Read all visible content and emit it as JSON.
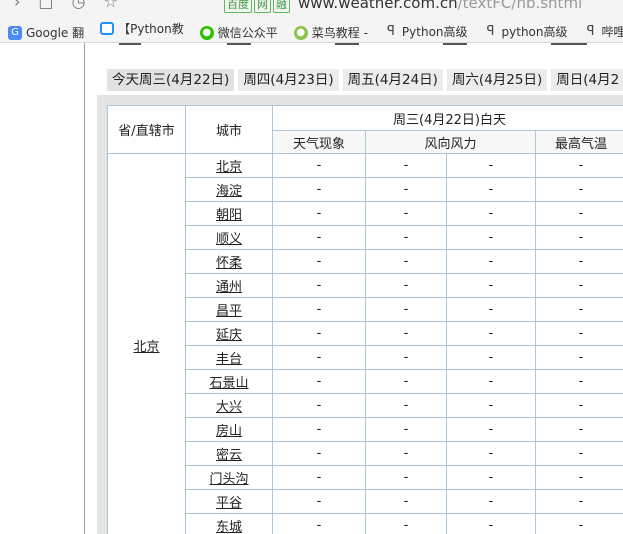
{
  "browser": {
    "url_badge_1": "百度",
    "url_badge_2": "网",
    "url_badge_3": "融",
    "url_host": "www.weather.com.cn",
    "url_path": "/textFC/hb.shtml",
    "bookmarks": [
      {
        "label": "Google 翻",
        "icon": "google-translate-icon"
      },
      {
        "label": "【Python教",
        "icon": "bilibili-icon"
      },
      {
        "label": "微信公众平",
        "icon": "wechat-icon"
      },
      {
        "label": "菜鸟教程 -",
        "icon": "runoob-icon"
      },
      {
        "label": "Python高级",
        "icon": "python-icon"
      },
      {
        "label": "python高级",
        "icon": "python-icon"
      },
      {
        "label": "哔哩哔",
        "icon": "python-icon"
      }
    ]
  },
  "tabs": [
    "今天周三(4月22日)",
    "周四(4月23日)",
    "周五(4月24日)",
    "周六(4月25日)",
    "周日(4月2"
  ],
  "table": {
    "header_province": "省/直辖市",
    "header_city": "城市",
    "header_period": "周三(4月22日)白天",
    "header_phenomenon": "天气现象",
    "header_wind": "风向风力",
    "header_max_temp": "最高气温",
    "province": "北京",
    "rows": [
      {
        "city": "北京",
        "phen": "-",
        "wdir": "-",
        "wpow": "-",
        "tmax": "-"
      },
      {
        "city": "海淀",
        "phen": "-",
        "wdir": "-",
        "wpow": "-",
        "tmax": "-"
      },
      {
        "city": "朝阳",
        "phen": "-",
        "wdir": "-",
        "wpow": "-",
        "tmax": "-"
      },
      {
        "city": "顺义",
        "phen": "-",
        "wdir": "-",
        "wpow": "-",
        "tmax": "-"
      },
      {
        "city": "怀柔",
        "phen": "-",
        "wdir": "-",
        "wpow": "-",
        "tmax": "-"
      },
      {
        "city": "通州",
        "phen": "-",
        "wdir": "-",
        "wpow": "-",
        "tmax": "-"
      },
      {
        "city": "昌平",
        "phen": "-",
        "wdir": "-",
        "wpow": "-",
        "tmax": "-"
      },
      {
        "city": "延庆",
        "phen": "-",
        "wdir": "-",
        "wpow": "-",
        "tmax": "-"
      },
      {
        "city": "丰台",
        "phen": "-",
        "wdir": "-",
        "wpow": "-",
        "tmax": "-"
      },
      {
        "city": "石景山",
        "phen": "-",
        "wdir": "-",
        "wpow": "-",
        "tmax": "-"
      },
      {
        "city": "大兴",
        "phen": "-",
        "wdir": "-",
        "wpow": "-",
        "tmax": "-"
      },
      {
        "city": "房山",
        "phen": "-",
        "wdir": "-",
        "wpow": "-",
        "tmax": "-"
      },
      {
        "city": "密云",
        "phen": "-",
        "wdir": "-",
        "wpow": "-",
        "tmax": "-"
      },
      {
        "city": "门头沟",
        "phen": "-",
        "wdir": "-",
        "wpow": "-",
        "tmax": "-"
      },
      {
        "city": "平谷",
        "phen": "-",
        "wdir": "-",
        "wpow": "-",
        "tmax": "-"
      },
      {
        "city": "东城",
        "phen": "-",
        "wdir": "-",
        "wpow": "-",
        "tmax": "-"
      }
    ]
  }
}
